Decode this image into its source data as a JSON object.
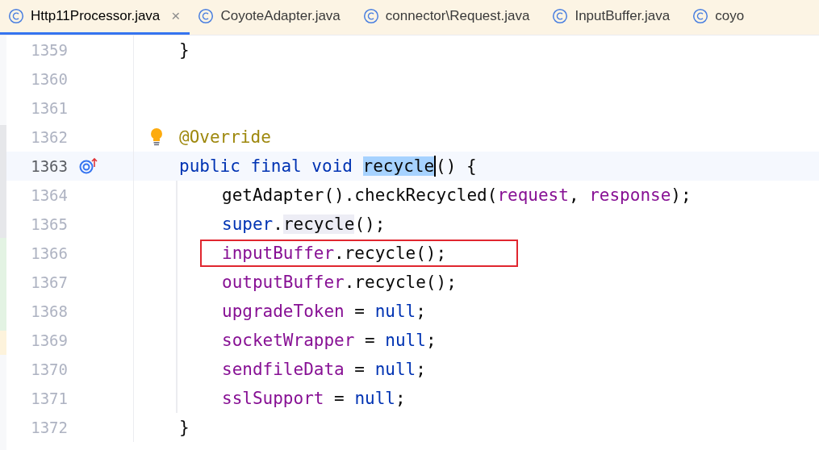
{
  "tabs": [
    {
      "label": "Http11Processor.java",
      "selected": true,
      "close": "×"
    },
    {
      "label": "CoyoteAdapter.java",
      "selected": false
    },
    {
      "label": "connector\\Request.java",
      "selected": false
    },
    {
      "label": "InputBuffer.java",
      "selected": false
    },
    {
      "label": "coyo",
      "selected": false
    }
  ],
  "editor": {
    "lines": [
      {
        "number": "1359",
        "current": false,
        "tokens": [
          {
            "kind": "plain",
            "text": "}"
          }
        ]
      },
      {
        "number": "1360",
        "current": false
      },
      {
        "number": "1361",
        "current": false
      },
      {
        "number": "1362",
        "current": false,
        "bulb": true,
        "tokens": [
          {
            "kind": "annotation",
            "text": "@Override"
          }
        ]
      },
      {
        "number": "1363",
        "current": true,
        "overrides": true,
        "tokens": [
          {
            "kind": "keyword",
            "text": "public final void "
          },
          {
            "kind": "plain",
            "text": "recycle",
            "selection": true,
            "caret": true
          },
          {
            "kind": "plain",
            "text": "() {"
          }
        ],
        "children": [
          {
            "number": "1364",
            "current": false,
            "tokens": [
              {
                "kind": "plain",
                "text": "getAdapter().checkRecycled("
              },
              {
                "kind": "field",
                "text": "request"
              },
              {
                "kind": "plain",
                "text": ", "
              },
              {
                "kind": "field",
                "text": "response"
              },
              {
                "kind": "plain",
                "text": ");"
              }
            ]
          },
          {
            "number": "1365",
            "current": false,
            "tokens": [
              {
                "kind": "keyword",
                "text": "super"
              },
              {
                "kind": "plain",
                "text": "."
              },
              {
                "kind": "plain",
                "text": "recycle",
                "usage": true
              },
              {
                "kind": "plain",
                "text": "();"
              }
            ]
          },
          {
            "number": "1366",
            "current": false,
            "boxed": true,
            "tokens": [
              {
                "kind": "field",
                "text": "inputBuffer"
              },
              {
                "kind": "plain",
                "text": ".recycle();"
              }
            ]
          },
          {
            "number": "1367",
            "current": false,
            "tokens": [
              {
                "kind": "field",
                "text": "outputBuffer"
              },
              {
                "kind": "plain",
                "text": ".recycle();"
              }
            ]
          },
          {
            "number": "1368",
            "current": false,
            "tokens": [
              {
                "kind": "field",
                "text": "upgradeToken"
              },
              {
                "kind": "plain",
                "text": " = "
              },
              {
                "kind": "keyword",
                "text": "null"
              },
              {
                "kind": "plain",
                "text": ";"
              }
            ]
          },
          {
            "number": "1369",
            "current": false,
            "tokens": [
              {
                "kind": "field",
                "text": "socketWrapper"
              },
              {
                "kind": "plain",
                "text": " = "
              },
              {
                "kind": "keyword",
                "text": "null"
              },
              {
                "kind": "plain",
                "text": ";"
              }
            ]
          },
          {
            "number": "1370",
            "current": false,
            "tokens": [
              {
                "kind": "field",
                "text": "sendfileData"
              },
              {
                "kind": "plain",
                "text": " = "
              },
              {
                "kind": "keyword",
                "text": "null"
              },
              {
                "kind": "plain",
                "text": ";"
              }
            ]
          },
          {
            "number": "1371",
            "current": false,
            "tokens": [
              {
                "kind": "field",
                "text": "sslSupport"
              },
              {
                "kind": "plain",
                "text": " = "
              },
              {
                "kind": "keyword",
                "text": "null"
              },
              {
                "kind": "plain",
                "text": ";"
              }
            ]
          }
        ]
      },
      {
        "number": "1372",
        "current": false,
        "tokens": [
          {
            "kind": "plain",
            "text": "}"
          }
        ]
      }
    ]
  }
}
